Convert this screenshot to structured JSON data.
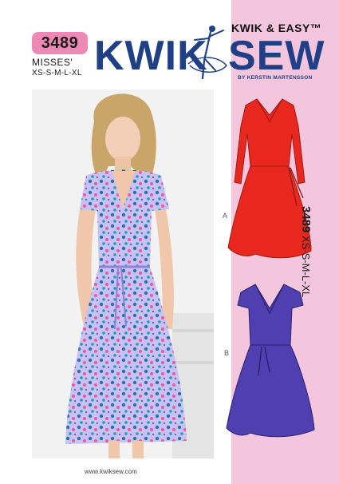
{
  "pattern": {
    "number": "3489",
    "category": "MISSES'",
    "sizes": "XS-S-M-L-XL"
  },
  "brand": {
    "tagline": "KWIK & EASY™",
    "name_left": "KWIK",
    "name_right": "SEW",
    "byline": "BY KERSTIN MARTENSSON"
  },
  "views": {
    "a_label": "A",
    "b_label": "B"
  },
  "side": {
    "number": "3489",
    "sizes": "XS-S-M-L-XL"
  },
  "footer": {
    "website": "www.kwiksew.com"
  },
  "colors": {
    "brand_blue": "#1f3f86",
    "badge_pink": "#ee88b4",
    "strip_pink": "#f3c6dd",
    "view_a_red": "#e8281e",
    "view_b_purple": "#4f3fb1",
    "dress_print": "#b9b4f0"
  }
}
